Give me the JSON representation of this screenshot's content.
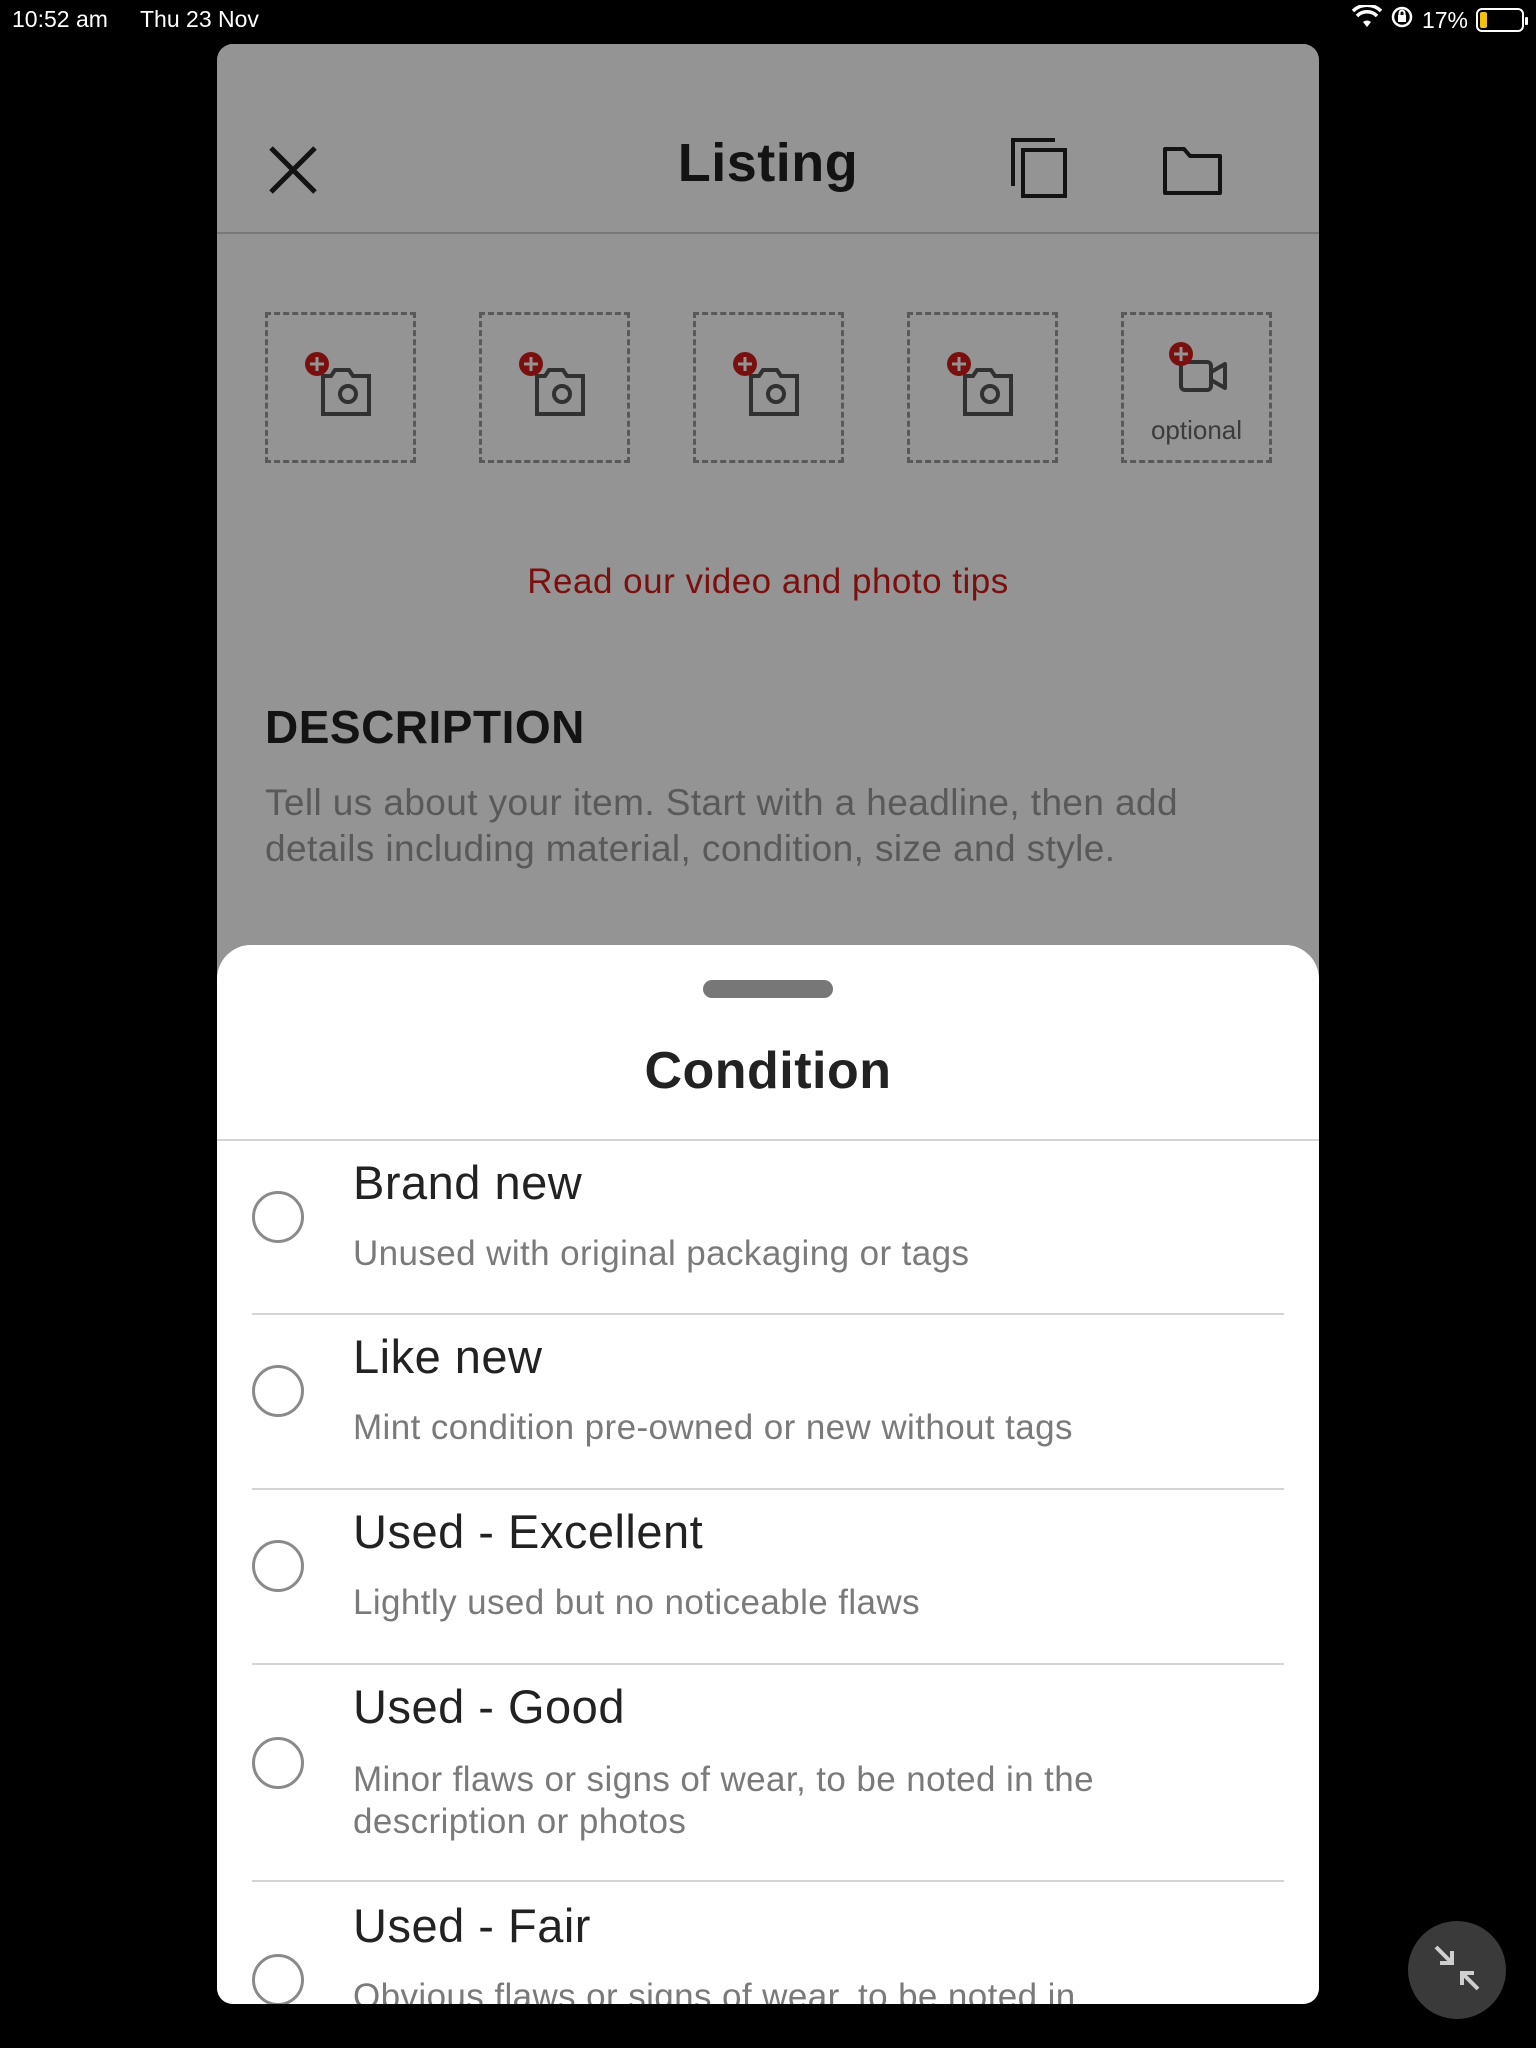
{
  "status_bar": {
    "time": "10:52 am",
    "date": "Thu 23 Nov",
    "battery": "17%",
    "battery_level": 0.17,
    "icons": [
      "wifi-icon",
      "lock-rotation-icon",
      "battery-charging-icon"
    ]
  },
  "header": {
    "title": "Listing",
    "icons": [
      "close-icon",
      "copy-icon",
      "folder-icon"
    ]
  },
  "media": {
    "slots": [
      {
        "icon": "add-photo-icon"
      },
      {
        "icon": "add-photo-icon"
      },
      {
        "icon": "add-photo-icon"
      },
      {
        "icon": "add-photo-icon"
      },
      {
        "icon": "add-video-icon",
        "label": "optional"
      }
    ],
    "tips_link": "Read our video and photo tips"
  },
  "description": {
    "title": "DESCRIPTION",
    "placeholder": "Tell us about your item. Start with a headline, then add details including material, condition, size and style."
  },
  "sheet": {
    "title": "Condition",
    "options": [
      {
        "label": "Brand new",
        "desc": "Unused with original packaging or tags"
      },
      {
        "label": "Like new",
        "desc": "Mint condition pre-owned or new without tags"
      },
      {
        "label": "Used - Excellent",
        "desc": "Lightly used but no noticeable flaws"
      },
      {
        "label": "Used - Good",
        "desc": "Minor flaws or signs of wear, to be noted in the description or photos"
      },
      {
        "label": "Used - Fair",
        "desc": "Obvious flaws or signs of wear, to be noted in"
      }
    ]
  },
  "colors": {
    "accent": "#d21b1b",
    "overlay": "rgba(0,0,0,0.42)"
  }
}
